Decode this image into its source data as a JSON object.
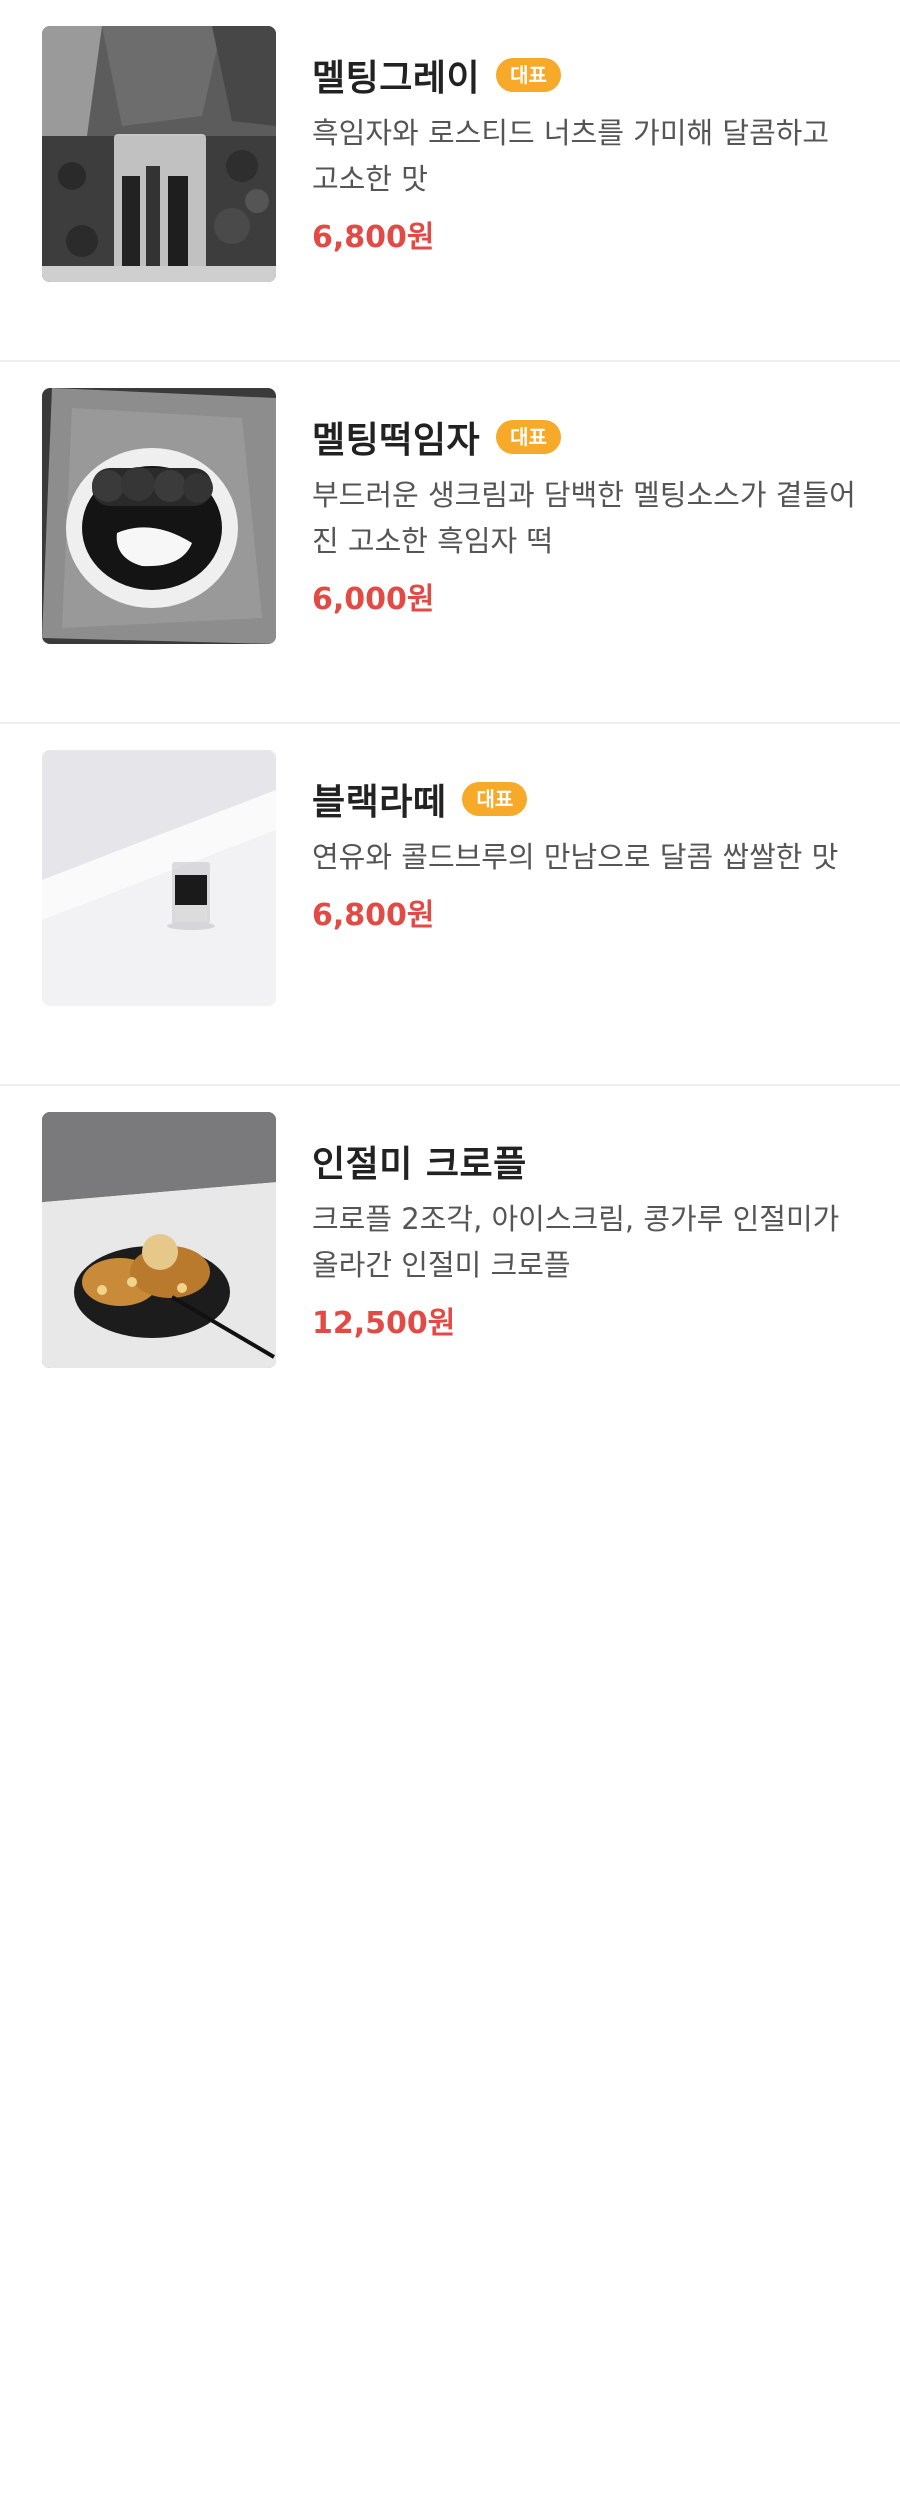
{
  "menu": {
    "items": [
      {
        "name": "멜팅그레이",
        "badge": "대표",
        "description": "흑임자와 로스티드 너츠를 가미해 달콤하고 고소한 맛",
        "price": "6,800원",
        "image_icon": "black-sesame-drink-photo"
      },
      {
        "name": "멜팅떡임자",
        "badge": "대표",
        "description": "부드러운 생크림과 담백한 멜팅소스가 곁들어진 고소한 흑임자 떡",
        "price": "6,000원",
        "image_icon": "rice-cake-plate-photo"
      },
      {
        "name": "블랙라떼",
        "badge": "대표",
        "description": "연유와 콜드브루의 만남으로 달콤 쌉쌀한 맛",
        "price": "6,800원",
        "image_icon": "black-latte-photo"
      },
      {
        "name": "인절미 크로플",
        "badge": "",
        "description": "크로플 2조각, 아이스크림, 콩가루 인절미가 올라간 인절미 크로플",
        "price": "12,500원",
        "image_icon": "croffle-photo"
      }
    ]
  },
  "colors": {
    "badge": "#f7a929",
    "price": "#e24a45",
    "divider": "#eeeeee"
  }
}
